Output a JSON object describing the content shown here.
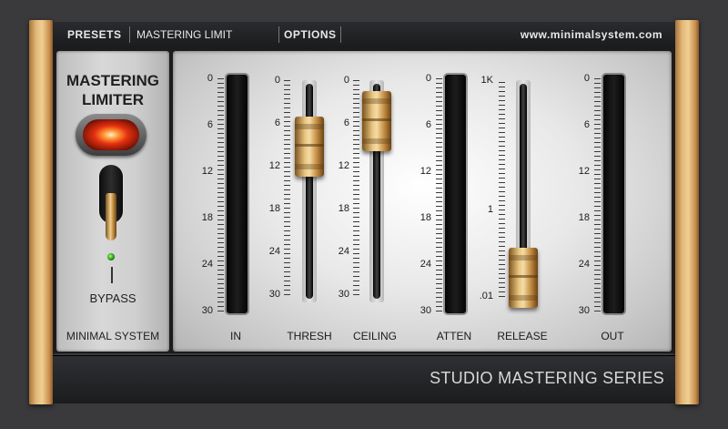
{
  "header": {
    "presets_label": "PRESETS",
    "preset_name": "MASTERING LIMIT",
    "options_label": "OPTIONS",
    "website": "www.minimalsystem.com"
  },
  "module": {
    "title_line1": "MASTERING",
    "title_line2": "LIMITER",
    "bypass_label": "BYPASS",
    "brand": "MINIMAL SYSTEM"
  },
  "scale_db": [
    "0",
    "6",
    "12",
    "18",
    "24",
    "30"
  ],
  "scale_release": [
    "1K",
    "1",
    ".01"
  ],
  "channels": {
    "in": "IN",
    "thresh": "THRESH",
    "ceiling": "CEILING",
    "atten": "ATTEN",
    "release": "RELEASE",
    "out": "OUT"
  },
  "fader_values_db": {
    "thresh": 10,
    "ceiling": 7
  },
  "footer": {
    "series": "STUDIO MASTERING SERIES"
  },
  "colors": {
    "wood": "#e3b978",
    "led": "#e4300f",
    "bypass_led": "#1f8b12"
  }
}
